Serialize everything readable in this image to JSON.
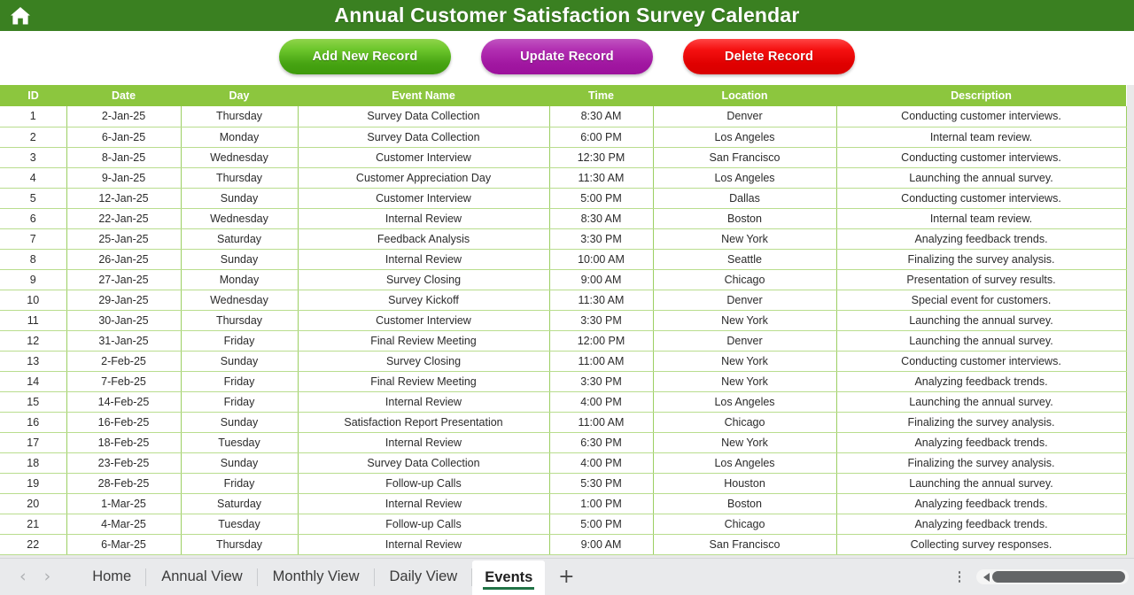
{
  "header": {
    "title": "Annual Customer Satisfaction Survey Calendar",
    "home_icon": "home-icon",
    "bar_color": "#3a8021"
  },
  "toolbar": {
    "add_label": "Add New Record",
    "update_label": "Update Record",
    "delete_label": "Delete Record",
    "add_color": "#4fae1b",
    "update_color": "#a817a8",
    "delete_color": "#ea0000"
  },
  "table": {
    "header_color": "#8cc63e",
    "grid_color": "#9ccf63",
    "columns": [
      "ID",
      "Date",
      "Day",
      "Event Name",
      "Time",
      "Location",
      "Description"
    ],
    "rows": [
      [
        "1",
        "2-Jan-25",
        "Thursday",
        "Survey Data Collection",
        "8:30 AM",
        "Denver",
        "Conducting customer interviews."
      ],
      [
        "2",
        "6-Jan-25",
        "Monday",
        "Survey Data Collection",
        "6:00 PM",
        "Los Angeles",
        "Internal team review."
      ],
      [
        "3",
        "8-Jan-25",
        "Wednesday",
        "Customer Interview",
        "12:30 PM",
        "San Francisco",
        "Conducting customer interviews."
      ],
      [
        "4",
        "9-Jan-25",
        "Thursday",
        "Customer Appreciation Day",
        "11:30 AM",
        "Los Angeles",
        "Launching the annual survey."
      ],
      [
        "5",
        "12-Jan-25",
        "Sunday",
        "Customer Interview",
        "5:00 PM",
        "Dallas",
        "Conducting customer interviews."
      ],
      [
        "6",
        "22-Jan-25",
        "Wednesday",
        "Internal Review",
        "8:30 AM",
        "Boston",
        "Internal team review."
      ],
      [
        "7",
        "25-Jan-25",
        "Saturday",
        "Feedback Analysis",
        "3:30 PM",
        "New York",
        "Analyzing feedback trends."
      ],
      [
        "8",
        "26-Jan-25",
        "Sunday",
        "Internal Review",
        "10:00 AM",
        "Seattle",
        "Finalizing the survey analysis."
      ],
      [
        "9",
        "27-Jan-25",
        "Monday",
        "Survey Closing",
        "9:00 AM",
        "Chicago",
        "Presentation of survey results."
      ],
      [
        "10",
        "29-Jan-25",
        "Wednesday",
        "Survey Kickoff",
        "11:30 AM",
        "Denver",
        "Special event for customers."
      ],
      [
        "11",
        "30-Jan-25",
        "Thursday",
        "Customer Interview",
        "3:30 PM",
        "New York",
        "Launching the annual survey."
      ],
      [
        "12",
        "31-Jan-25",
        "Friday",
        "Final Review Meeting",
        "12:00 PM",
        "Denver",
        "Launching the annual survey."
      ],
      [
        "13",
        "2-Feb-25",
        "Sunday",
        "Survey Closing",
        "11:00 AM",
        "New York",
        "Conducting customer interviews."
      ],
      [
        "14",
        "7-Feb-25",
        "Friday",
        "Final Review Meeting",
        "3:30 PM",
        "New York",
        "Analyzing feedback trends."
      ],
      [
        "15",
        "14-Feb-25",
        "Friday",
        "Internal Review",
        "4:00 PM",
        "Los Angeles",
        "Launching the annual survey."
      ],
      [
        "16",
        "16-Feb-25",
        "Sunday",
        "Satisfaction Report Presentation",
        "11:00 AM",
        "Chicago",
        "Finalizing the survey analysis."
      ],
      [
        "17",
        "18-Feb-25",
        "Tuesday",
        "Internal Review",
        "6:30 PM",
        "New York",
        "Analyzing feedback trends."
      ],
      [
        "18",
        "23-Feb-25",
        "Sunday",
        "Survey Data Collection",
        "4:00 PM",
        "Los Angeles",
        "Finalizing the survey analysis."
      ],
      [
        "19",
        "28-Feb-25",
        "Friday",
        "Follow-up Calls",
        "5:30 PM",
        "Houston",
        "Launching the annual survey."
      ],
      [
        "20",
        "1-Mar-25",
        "Saturday",
        "Internal Review",
        "1:00 PM",
        "Boston",
        "Analyzing feedback trends."
      ],
      [
        "21",
        "4-Mar-25",
        "Tuesday",
        "Follow-up Calls",
        "5:00 PM",
        "Chicago",
        "Analyzing feedback trends."
      ],
      [
        "22",
        "6-Mar-25",
        "Thursday",
        "Internal Review",
        "9:00 AM",
        "San Francisco",
        "Collecting survey responses."
      ]
    ]
  },
  "tabbar": {
    "prev_icon": "chevron-left-icon",
    "next_icon": "chevron-right-icon",
    "tabs": [
      {
        "label": "Home",
        "active": false
      },
      {
        "label": "Annual View",
        "active": false
      },
      {
        "label": "Monthly View",
        "active": false
      },
      {
        "label": "Daily View",
        "active": false
      },
      {
        "label": "Events",
        "active": true
      }
    ],
    "add_sheet_label": "+",
    "active_tab_accent": "#217346",
    "options_icon": "kebab-menu-icon",
    "scroll_icon": "scroll-left-arrow-icon"
  }
}
